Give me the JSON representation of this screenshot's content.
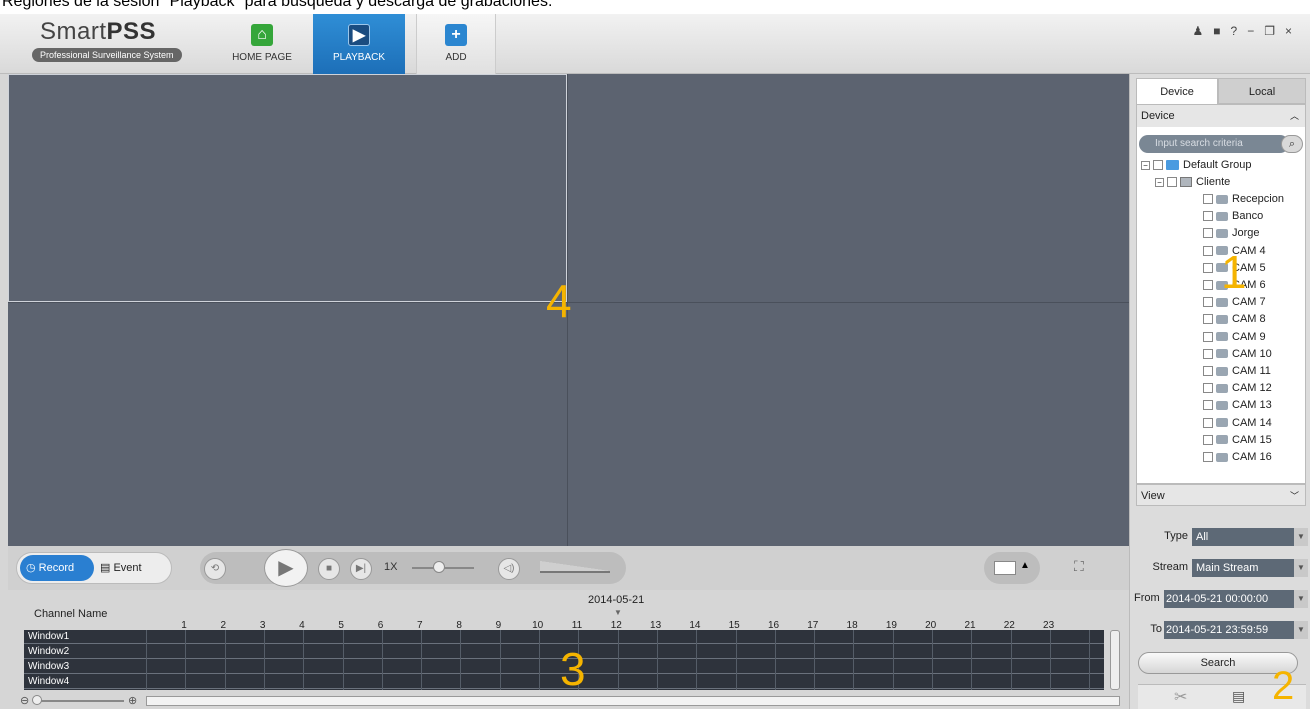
{
  "caption": "Regiones de la sesión \"Playback\" para búsqueda y descarga de grabaciones.",
  "app": {
    "logo_title_a": "Smart",
    "logo_title_b": "PSS",
    "logo_subtitle": "Professional Surveillance System"
  },
  "nav": {
    "home": "HOME PAGE",
    "playback": "PLAYBACK",
    "add": "ADD"
  },
  "window_controls": [
    "user-icon",
    "lock-icon",
    "?",
    "−",
    "restore-icon",
    "×"
  ],
  "controls": {
    "record_tab": "Record",
    "event_tab": "Event",
    "speed": "1X"
  },
  "timeline": {
    "date": "2014-05-21",
    "channel_header": "Channel Name",
    "hours": [
      "1",
      "2",
      "3",
      "4",
      "5",
      "6",
      "7",
      "8",
      "9",
      "10",
      "11",
      "12",
      "13",
      "14",
      "15",
      "16",
      "17",
      "18",
      "19",
      "20",
      "21",
      "22",
      "23"
    ],
    "channels": [
      "Window1",
      "Window2",
      "Window3",
      "Window4"
    ]
  },
  "panel": {
    "tab_device": "Device",
    "tab_local": "Local",
    "section_device": "Device",
    "search_placeholder": "Input search criteria",
    "group": "Default Group",
    "device": "Cliente",
    "cameras": [
      "Recepcion",
      "Banco",
      "Jorge",
      "CAM 4",
      "CAM 5",
      "CAM 6",
      "CAM 7",
      "CAM 8",
      "CAM 9",
      "CAM 10",
      "CAM 11",
      "CAM 12",
      "CAM 13",
      "CAM 14",
      "CAM 15",
      "CAM 16"
    ],
    "section_view": "View",
    "type_label": "Type",
    "type_value": "All",
    "stream_label": "Stream",
    "stream_value": "Main Stream",
    "from_label": "From",
    "from_value": "2014-05-21 00:00:00",
    "to_label": "To",
    "to_value": "2014-05-21 23:59:59",
    "search_button": "Search"
  },
  "region_labels": [
    "1",
    "2",
    "3",
    "4"
  ],
  "colors": {
    "accent": "#2a7fd1",
    "region_label": "#f5b400",
    "video_bg": "#5c6370"
  }
}
